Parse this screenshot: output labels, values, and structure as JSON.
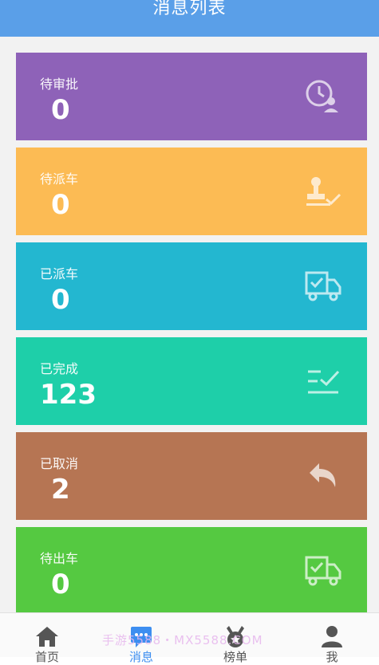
{
  "header": {
    "title": "消息列表"
  },
  "cards": [
    {
      "label": "待审批",
      "count": "0",
      "color": "#8e62b8",
      "icon": "clock-user-icon"
    },
    {
      "label": "待派车",
      "count": "0",
      "color": "#fcbb54",
      "icon": "stamp-check-icon"
    },
    {
      "label": "已派车",
      "count": "0",
      "color": "#23b7d0",
      "icon": "truck-check-icon"
    },
    {
      "label": "已完成",
      "count": "123",
      "color": "#1ecfa9",
      "icon": "list-check-icon"
    },
    {
      "label": "已取消",
      "count": "2",
      "color": "#b67553",
      "icon": "undo-arrow-icon"
    },
    {
      "label": "待出车",
      "count": "0",
      "color": "#55c941",
      "icon": "truck-check-icon"
    }
  ],
  "tabbar": {
    "tabs": [
      {
        "label": "首页",
        "icon": "home-icon",
        "active": false
      },
      {
        "label": "消息",
        "icon": "message-icon",
        "active": true
      },
      {
        "label": "榜单",
        "icon": "medal-icon",
        "active": false
      },
      {
        "label": "我",
        "icon": "user-icon",
        "active": false
      }
    ]
  },
  "watermark": "手游5588・MX5588.COM"
}
